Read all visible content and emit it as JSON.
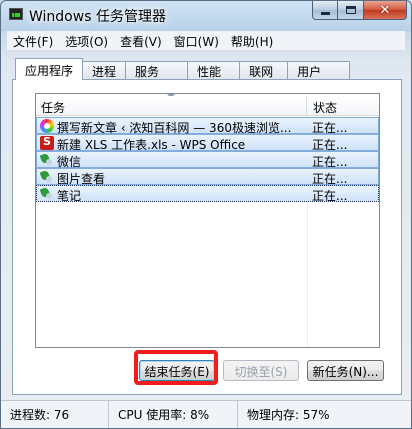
{
  "window": {
    "title": "Windows 任务管理器"
  },
  "menu": [
    "文件(F)",
    "选项(O)",
    "查看(V)",
    "窗口(W)",
    "帮助(H)"
  ],
  "tabs": [
    "应用程序",
    "进程",
    "服务",
    "性能",
    "联网",
    "用户"
  ],
  "list": {
    "headers": {
      "task": "任务",
      "status": "状态"
    },
    "rows": [
      {
        "name": "撰写新文章 ‹ 浓知百科网 — 360极速浏览...",
        "status": "正在...",
        "icon": "360-browser-icon"
      },
      {
        "name": "新建 XLS 工作表.xls - WPS Office",
        "status": "正在...",
        "icon": "wps-icon"
      },
      {
        "name": "微信",
        "status": "正在...",
        "icon": "app-icon"
      },
      {
        "name": "图片查看",
        "status": "正在...",
        "icon": "app-icon"
      },
      {
        "name": "笔记",
        "status": "正在...",
        "icon": "app-icon"
      }
    ]
  },
  "buttons": {
    "end_task": "结束任务(E)",
    "switch_to": "切换至(S)",
    "new_task": "新任务(N)..."
  },
  "status": {
    "processes": "进程数: 76",
    "cpu": "CPU 使用率: 8%",
    "memory": "物理内存: 57%"
  },
  "colors": {
    "highlight": "#f21c1c",
    "selection": "#cfe2f8"
  }
}
